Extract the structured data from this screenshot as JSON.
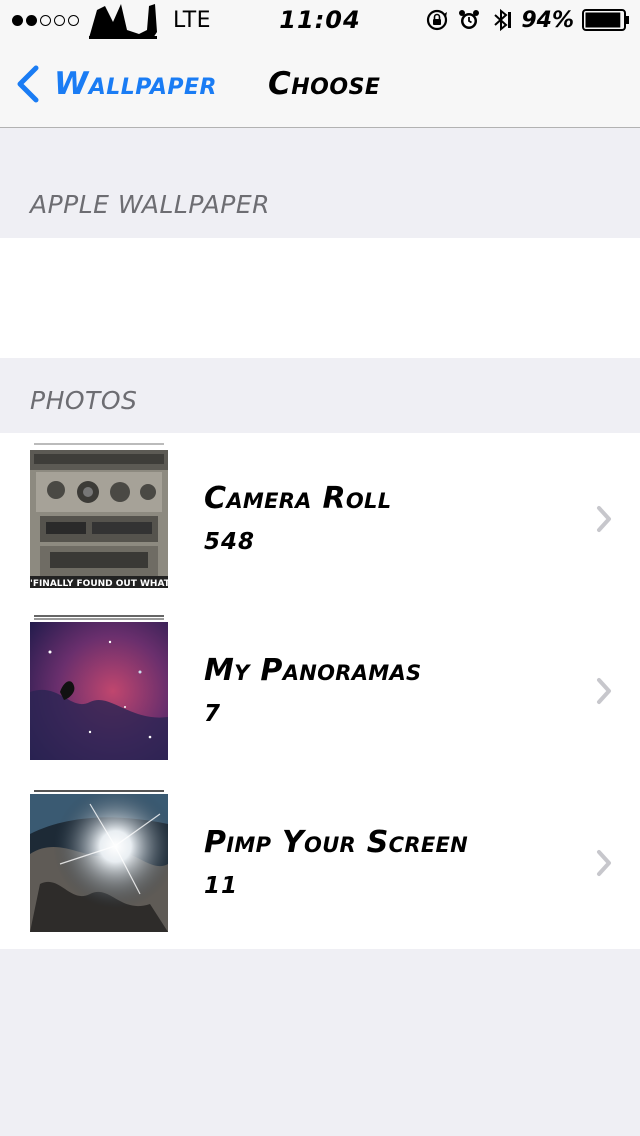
{
  "status_bar": {
    "signal_filled": 2,
    "signal_total": 5,
    "network": "LTE",
    "time": "11:04",
    "battery_percent": "94%",
    "battery_level": 0.94,
    "icons": [
      "rotation-lock-icon",
      "alarm-icon",
      "bluetooth-icon",
      "battery-icon"
    ]
  },
  "nav": {
    "back_label": "Wallpaper",
    "title": "Choose"
  },
  "sections": {
    "apple_header": "APPLE WALLPAPER",
    "photos_header": "PHOTOS"
  },
  "albums": [
    {
      "name": "Camera Roll",
      "count": "548",
      "thumb_caption": "\"FINALLY FOUND OUT WHAT"
    },
    {
      "name": "My Panoramas",
      "count": "7"
    },
    {
      "name": "Pimp Your Screen",
      "count": "11"
    }
  ],
  "colors": {
    "accent": "#1a7cf4",
    "background": "#efeff4",
    "header_text": "#6d6d72",
    "chevron": "#c7c7cc"
  }
}
